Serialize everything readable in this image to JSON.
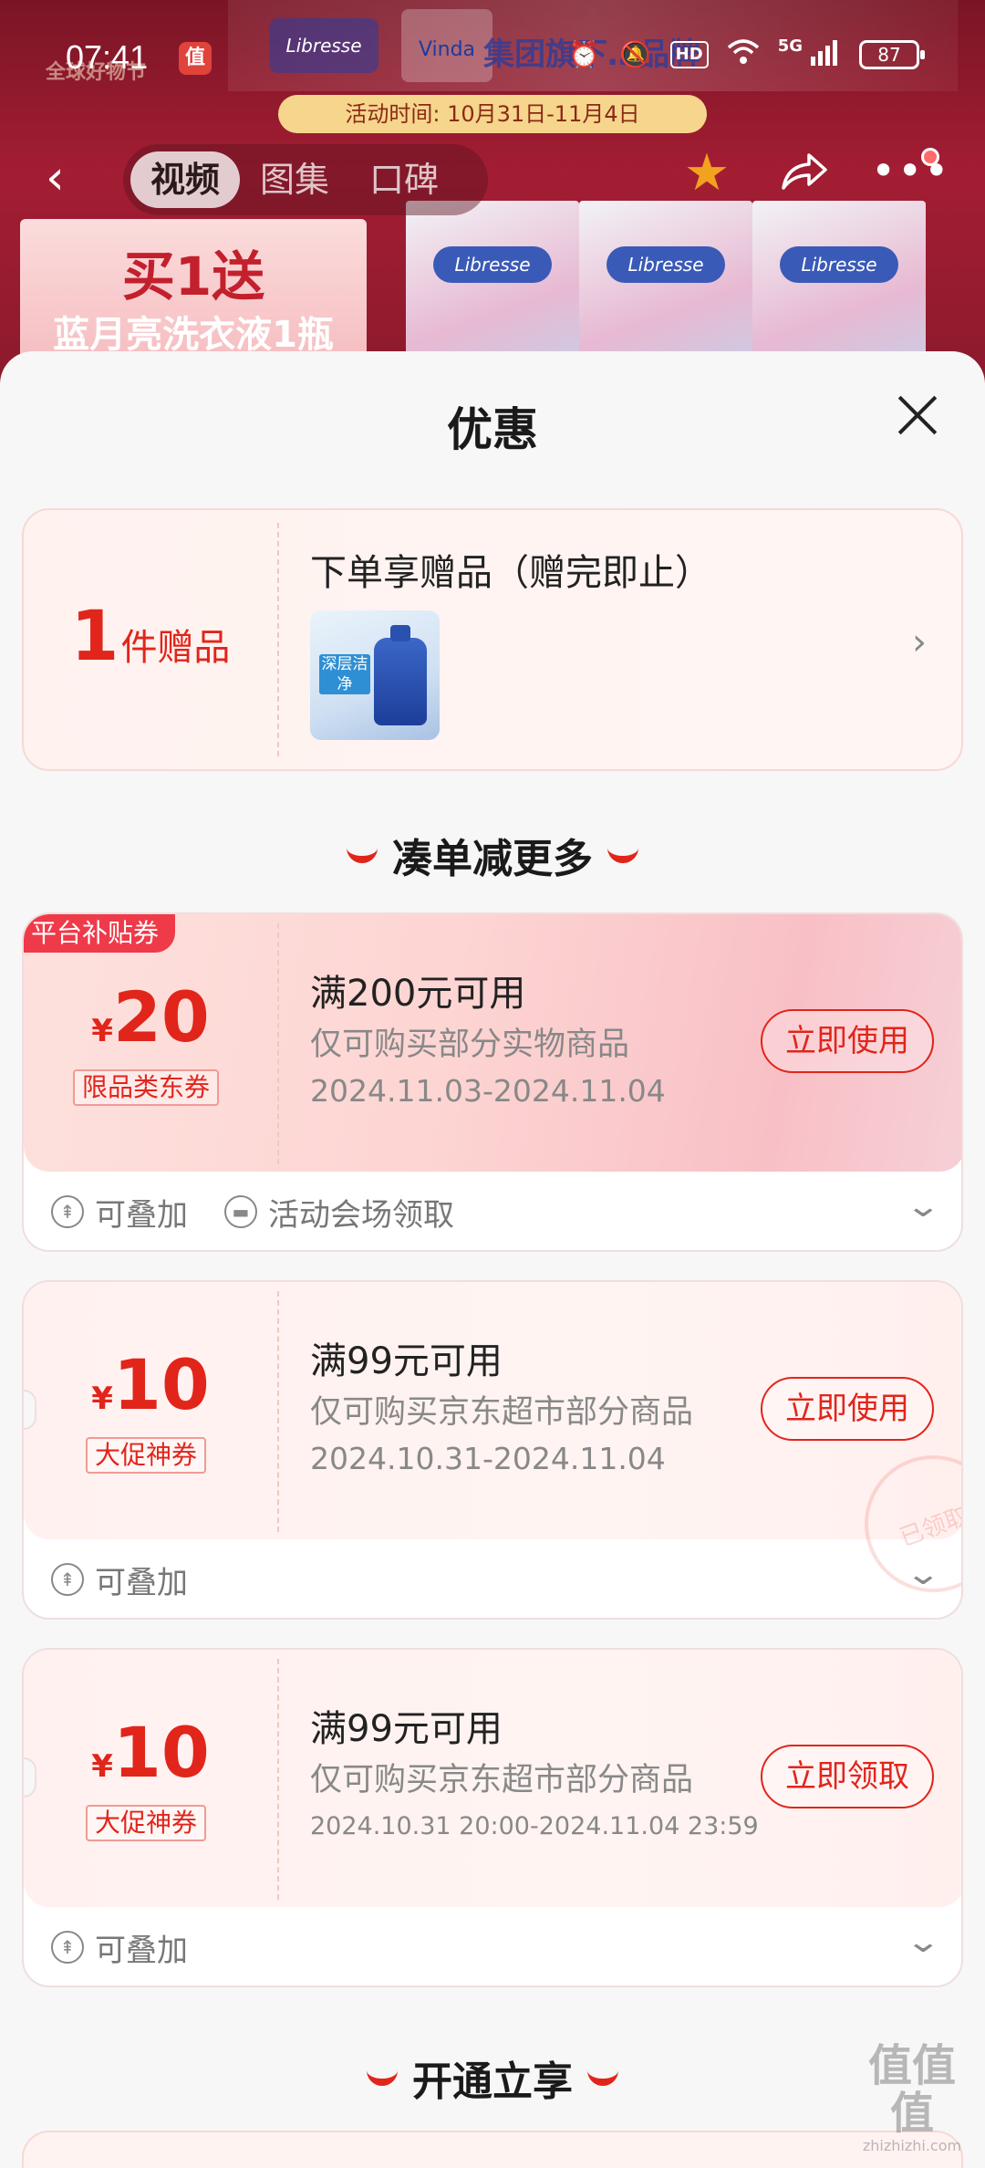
{
  "status_bar": {
    "time": "07:41",
    "app_icon": "值",
    "hd": "HD",
    "signal": "5G",
    "battery": "87",
    "icons": [
      "alarm-icon",
      "mute-icon",
      "wifi-icon",
      "signal-icon"
    ]
  },
  "background": {
    "logo_text": "全球好物节",
    "brand_a": "Libresse",
    "brand_b": "Vinda",
    "brand_text": "集团旗下…品牌",
    "activity_time": "活动时间: 10月31日-11月4日",
    "promo_line1": "买1送",
    "promo_line2": "蓝月亮洗衣液1瓶",
    "product_brand": "Libresse"
  },
  "nav": {
    "tabs": [
      {
        "label": "视频",
        "active": true
      },
      {
        "label": "图集",
        "active": false
      },
      {
        "label": "口碑",
        "active": false
      }
    ]
  },
  "sheet": {
    "title": "优惠",
    "gift": {
      "count": "1",
      "unit": "件赠品",
      "title": "下单享赠品（赠完即止）",
      "thumb_label": "深层洁净"
    },
    "section1_heading": "凑单减更多",
    "coupons": [
      {
        "badge": "平台补贴券",
        "currency": "¥",
        "amount": "20",
        "type": "限品类东券",
        "condition": "满200元可用",
        "scope": "仅可购买部分实物商品",
        "date": "2024.11.03-2024.11.04",
        "button": "立即使用",
        "tags": [
          "可叠加",
          "活动会场领取"
        ]
      },
      {
        "badge": "",
        "currency": "¥",
        "amount": "10",
        "type": "大促神券",
        "condition": "满99元可用",
        "scope": "仅可购买京东超市部分商品",
        "date": "2024.10.31-2024.11.04",
        "button": "立即使用",
        "stamp": "已领取",
        "tags": [
          "可叠加"
        ]
      },
      {
        "badge": "",
        "currency": "¥",
        "amount": "10",
        "type": "大促神券",
        "condition": "满99元可用",
        "scope": "仅可购买京东超市部分商品",
        "date": "2024.10.31 20:00-2024.11.04 23:59",
        "button": "立即领取",
        "tags": [
          "可叠加"
        ]
      }
    ],
    "section2_heading": "开通立享"
  },
  "watermark": {
    "text": "值值值",
    "url": "zhizhizhi.com"
  }
}
